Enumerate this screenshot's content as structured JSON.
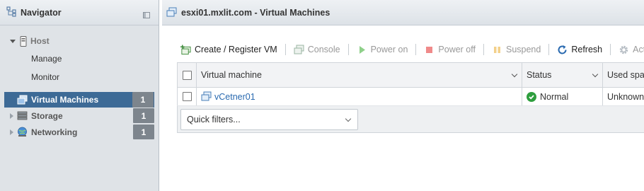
{
  "navigator": {
    "title": "Navigator",
    "host": {
      "label": "Host",
      "children": [
        {
          "label": "Manage"
        },
        {
          "label": "Monitor"
        }
      ]
    },
    "items": [
      {
        "label": "Virtual Machines",
        "count": "1",
        "active": true,
        "icon": "vm-icon"
      },
      {
        "label": "Storage",
        "count": "1",
        "active": false,
        "icon": "storage-icon"
      },
      {
        "label": "Networking",
        "count": "1",
        "active": false,
        "icon": "network-icon"
      }
    ]
  },
  "main": {
    "title": "esxi01.mxlit.com - Virtual Machines",
    "toolbar": {
      "create_register": "Create / Register VM",
      "console": "Console",
      "power_on": "Power on",
      "power_off": "Power off",
      "suspend": "Suspend",
      "refresh": "Refresh",
      "actions": "Actions"
    },
    "table": {
      "columns": {
        "vm": "Virtual machine",
        "status": "Status",
        "used": "Used space"
      },
      "rows": [
        {
          "name": "vCetner01",
          "status": "Normal",
          "used": "Unknown"
        }
      ]
    },
    "filter": {
      "placeholder": "Quick filters..."
    }
  },
  "colors": {
    "active_nav": "#3d6a96",
    "link": "#2a6ab0",
    "status_ok": "#2e9e3e"
  }
}
